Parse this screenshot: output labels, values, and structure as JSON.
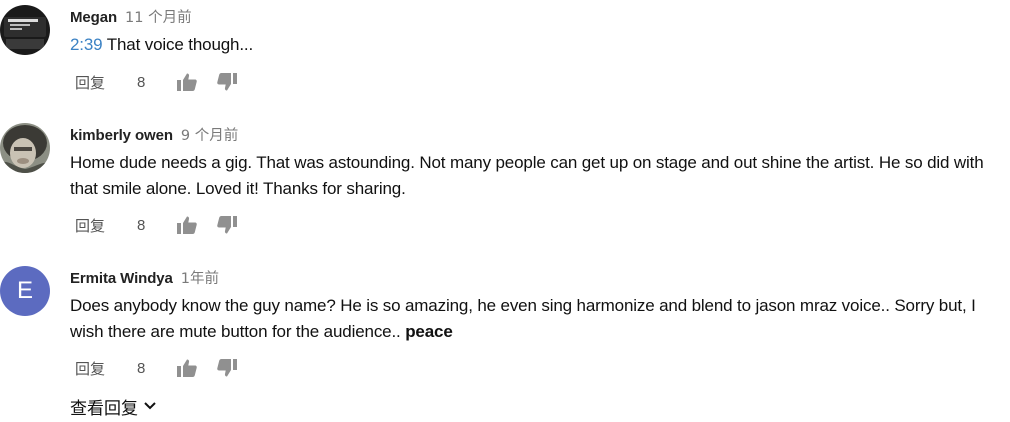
{
  "comments": [
    {
      "author": "Megan",
      "time": "11 个月前",
      "timestamp": "2:39",
      "text": " That voice though...",
      "reply_label": "回复",
      "likes": "8"
    },
    {
      "author": "kimberly owen",
      "time": "9 个月前",
      "text": "Home dude needs a gig. That was astounding. Not many people can get up on stage and out shine the artist. He so did with that smile alone. Loved it! Thanks for sharing.",
      "reply_label": "回复",
      "likes": "8"
    },
    {
      "author": "Ermita Windya",
      "time": "1年前",
      "avatar_letter": "E",
      "text": "Does anybody know the guy name? He is so amazing, he even sing harmonize and blend to jason mraz voice.. Sorry but, I wish there are mute button for the audience.. ",
      "bold_text": "peace",
      "reply_label": "回复",
      "likes": "8"
    }
  ],
  "view_replies_label": "查看回复",
  "colors": {
    "link": "#3b82c4",
    "avatar_e": "#5c6bc0",
    "muted_text": "#7a7a7a",
    "icon": "#909090"
  },
  "icons": [
    "thumb-up-icon",
    "thumb-down-icon",
    "chevron-down-icon"
  ]
}
